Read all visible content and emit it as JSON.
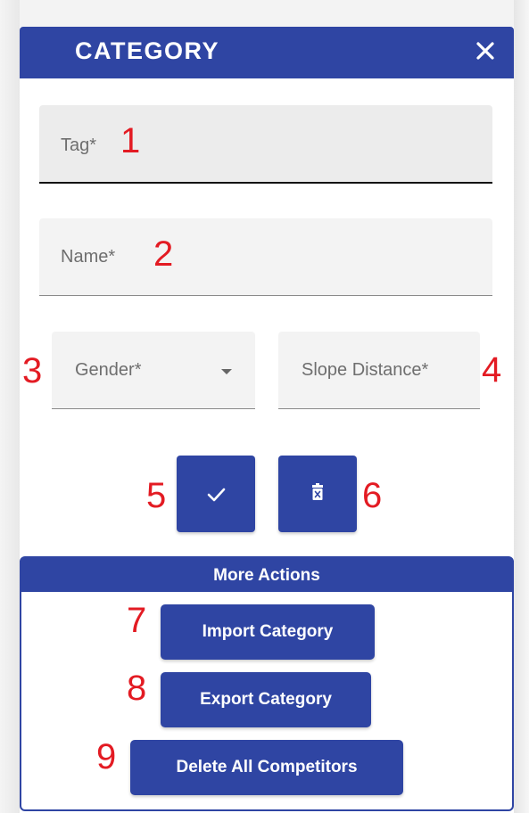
{
  "dialog": {
    "title": "CATEGORY",
    "close_icon": "close-icon"
  },
  "form": {
    "tag": {
      "label": "Tag*",
      "value": ""
    },
    "name": {
      "label": "Name*",
      "value": ""
    },
    "gender": {
      "label": "Gender*",
      "value": "",
      "icon": "dropdown-arrow-icon"
    },
    "slope_distance": {
      "label": "Slope Distance*",
      "value": ""
    }
  },
  "buttons": {
    "save_icon": "check-icon",
    "delete_icon": "trash-x-icon"
  },
  "more_actions": {
    "title": "More Actions",
    "import_label": "Import Category",
    "export_label": "Export Category",
    "delete_all_label": "Delete All Competitors"
  },
  "markers": [
    "1",
    "2",
    "3",
    "4",
    "5",
    "6",
    "7",
    "8",
    "9"
  ],
  "colors": {
    "primary": "#2f45a3",
    "marker": "#e31b23",
    "field_bg": "#f3f3f3"
  }
}
